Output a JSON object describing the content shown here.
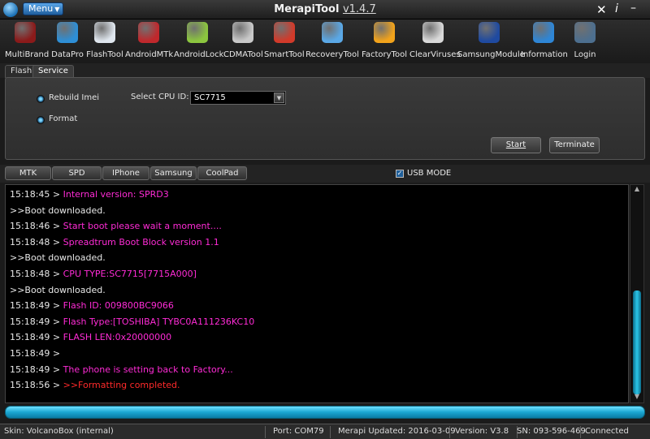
{
  "titlebar": {
    "menu_label": "Menu",
    "app_name": "MerapiTool",
    "version": "v1.4.7",
    "close_glyph": "✕",
    "info_glyph": "i",
    "minimize_glyph": "–"
  },
  "toolbar": {
    "items": [
      {
        "label": "MultiBrand",
        "icon": "multibrand-icon",
        "color": "#8b1a1a"
      },
      {
        "label": "DataPro",
        "icon": "datapro-icon",
        "color": "#2e8fd6"
      },
      {
        "label": "FlashTool",
        "icon": "flashtool-icon",
        "color": "#dfe6ee"
      },
      {
        "label": "AndroidMTk",
        "icon": "androidmtk-icon",
        "color": "#c0282c"
      },
      {
        "label": "AndroidLock",
        "icon": "androidlock-icon",
        "color": "#8cc63f"
      },
      {
        "label": "CDMATool",
        "icon": "cdmatool-icon",
        "color": "#c9c9c9"
      },
      {
        "label": "SmartTool",
        "icon": "smarttool-icon",
        "color": "#d23a2a"
      },
      {
        "label": "RecoveryTool",
        "icon": "recoverytool-icon",
        "color": "#5aa8e6"
      },
      {
        "label": "FactoryTool",
        "icon": "factorytool-icon",
        "color": "#f2a31b"
      },
      {
        "label": "ClearViruses",
        "icon": "clearviruses-icon",
        "color": "#d9d9d9"
      },
      {
        "label": "SamsungModule",
        "icon": "samsungmodule-icon",
        "color": "#1f4aa0"
      },
      {
        "label": "Information",
        "icon": "information-icon",
        "color": "#2e86d6"
      },
      {
        "label": "Login",
        "icon": "login-icon",
        "color": "#4d6f8f"
      }
    ]
  },
  "subtabs": {
    "flash": "Flash",
    "service": "Service"
  },
  "service": {
    "rebuild_imei_label": "Rebuild Imei",
    "format_label": "Format",
    "cpu_label": "Select CPU ID:",
    "cpu_value": "SC7715",
    "start_label": "Start",
    "terminate_label": "Terminate"
  },
  "brands": {
    "tabs": [
      "MTK",
      "SPD",
      "IPhone",
      "Samsung",
      "CoolPad"
    ],
    "usb_mode_label": "USB MODE"
  },
  "log": {
    "lines": [
      {
        "ts": "15:18:45 > ",
        "text": "Internal version: SPRD3",
        "color": "#ff2bd6"
      },
      {
        "ts": "",
        "text": ">>Boot downloaded.",
        "color": "#e8e8e8"
      },
      {
        "ts": "15:18:46 > ",
        "text": "Start boot please wait a moment....",
        "color": "#ff2bd6"
      },
      {
        "ts": "15:18:48 > ",
        "text": "Spreadtrum Boot Block version 1.1",
        "color": "#ff2bd6"
      },
      {
        "ts": "",
        "text": ">>Boot downloaded.",
        "color": "#e8e8e8"
      },
      {
        "ts": "15:18:48 > ",
        "text": "CPU TYPE:SC7715[7715A000]",
        "color": "#ff2bd6"
      },
      {
        "ts": "",
        "text": ">>Boot downloaded.",
        "color": "#e8e8e8"
      },
      {
        "ts": "15:18:49 > ",
        "text": "Flash ID: 009800BC9066",
        "color": "#ff2bd6"
      },
      {
        "ts": "15:18:49 > ",
        "text": "Flash Type:[TOSHIBA] TYBC0A111236KC10",
        "color": "#ff2bd6"
      },
      {
        "ts": "15:18:49 > ",
        "text": "FLASH LEN:0x20000000",
        "color": "#ff2bd6"
      },
      {
        "ts": "15:18:49 > ",
        "text": "",
        "color": "#ff2bd6"
      },
      {
        "ts": "15:18:49 > ",
        "text": "The phone is setting back to Factory...",
        "color": "#ff2bd6"
      },
      {
        "ts": "15:18:56 > ",
        "text": ">>Formatting completed.",
        "color": "#ff2a2a"
      }
    ]
  },
  "progress": {
    "value": 1.0
  },
  "statusbar": {
    "skin": "Skin: VolcanoBox (internal)",
    "port": "Port: COM79",
    "updated": "Merapi Updated: 2016-03-09",
    "version": "Version: V3.8",
    "sn": "SN: 093-596-469",
    "connection": "Connected"
  }
}
